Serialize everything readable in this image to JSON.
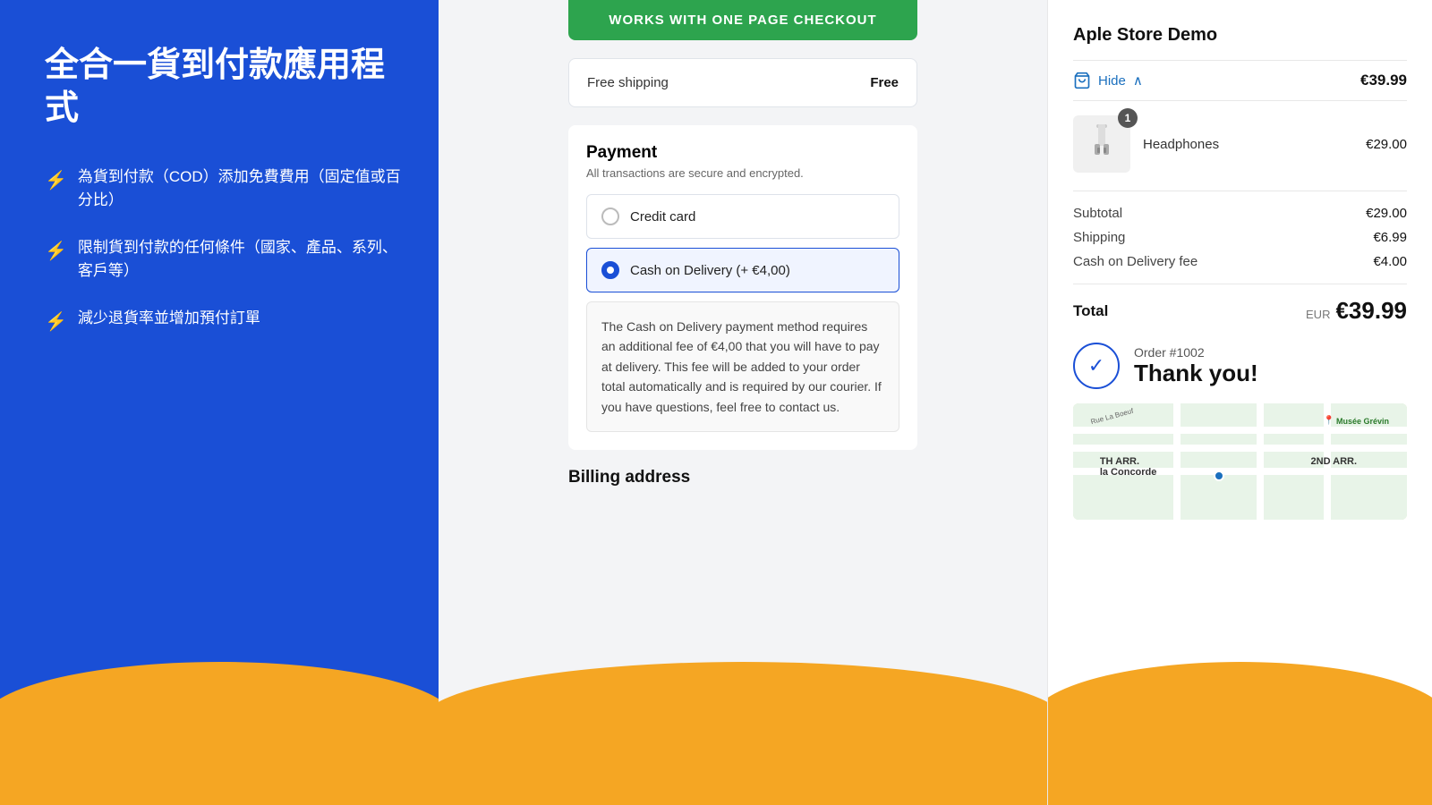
{
  "left": {
    "title": "全合一貨到付款應用程式",
    "features": [
      "為貨到付款（COD）添加免費費用（固定值或百分比）",
      "限制貨到付款的任何條件（國家、產品、系列、客戶等）",
      "減少退貨率並增加預付訂單"
    ]
  },
  "middle": {
    "banner": "WORKS WITH ONE PAGE CHECKOUT",
    "shipping": {
      "label": "Free shipping",
      "price": "Free"
    },
    "payment": {
      "title": "Payment",
      "subtitle": "All transactions are secure and encrypted.",
      "options": [
        {
          "id": "credit",
          "label": "Credit card",
          "selected": false
        },
        {
          "id": "cod",
          "label": "Cash on Delivery (+ €4,00)",
          "selected": true
        }
      ],
      "cod_description": "The Cash on Delivery payment method requires an additional fee of €4,00 that you will have to pay at delivery. This fee will be added to your order total automatically and is required by our courier. If you have questions, feel free to contact us."
    },
    "billing": {
      "title": "Billing address"
    }
  },
  "right": {
    "store_name": "Aple Store Demo",
    "cart": {
      "hide_label": "Hide",
      "total_header": "€39.99",
      "item": {
        "name": "Headphones",
        "price": "€29.00",
        "quantity": 1
      }
    },
    "summary": {
      "subtotal_label": "Subtotal",
      "subtotal_value": "€29.00",
      "shipping_label": "Shipping",
      "shipping_value": "€6.99",
      "cod_label": "Cash on Delivery fee",
      "cod_value": "€4.00"
    },
    "total": {
      "label": "Total",
      "currency": "EUR",
      "amount": "€39.99"
    },
    "order": {
      "number": "Order #1002",
      "thank_you": "Thank you!"
    }
  }
}
